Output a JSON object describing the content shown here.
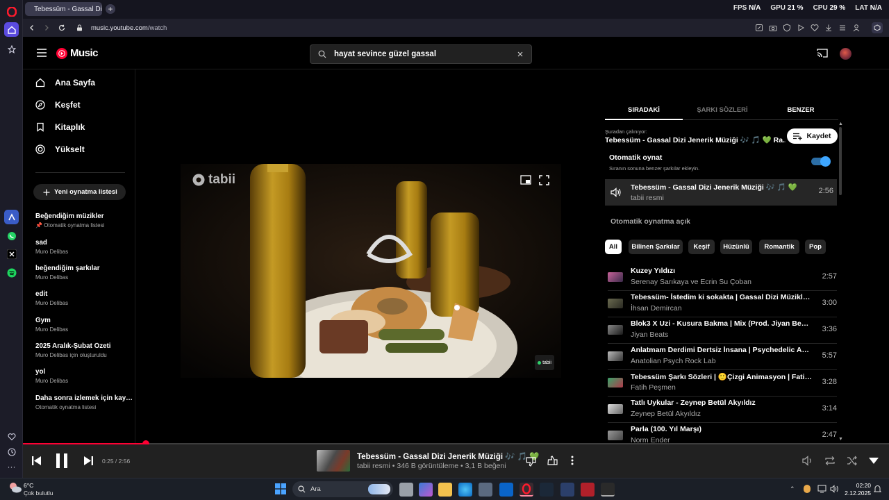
{
  "browser": {
    "tab_title": "Tebessüm - Gassal Di",
    "url_host": "music.youtube.com",
    "url_path": "/watch",
    "perf": [
      {
        "label": "FPS",
        "value": "N/A"
      },
      {
        "label": "GPU",
        "value": "21 %"
      },
      {
        "label": "CPU",
        "value": "29 %"
      },
      {
        "label": "LAT",
        "value": "N/A"
      }
    ]
  },
  "header": {
    "logo_text": "Music",
    "search_value": "hayat sevince güzel gassal"
  },
  "nav": {
    "items": [
      "Ana Sayfa",
      "Keşfet",
      "Kitaplık",
      "Yükselt"
    ],
    "new_playlist": "Yeni oynatma listesi",
    "playlists": [
      {
        "title": "Beğendiğim müzikler",
        "sub": "Otomatik oynatma listesi"
      },
      {
        "title": "sad",
        "sub": "Muro Delibas"
      },
      {
        "title": "beğendiğim şarkılar",
        "sub": "Muro Delibas"
      },
      {
        "title": "edit",
        "sub": "Muro Delibas"
      },
      {
        "title": "Gym",
        "sub": "Muro Delibas"
      },
      {
        "title": "2025 Aralık-Şubat Özeti",
        "sub": "Muro Delibas için oluşturuldu"
      },
      {
        "title": "yol",
        "sub": "Muro Delibas"
      },
      {
        "title": "Daha sonra izlemek için kayd...",
        "sub": "Otomatik oynatma listesi"
      }
    ]
  },
  "video": {
    "watermark": "tabii",
    "corner_badge": "tabii"
  },
  "panel": {
    "tabs": [
      "SIRADAKİ",
      "ŞARKI SÖZLERİ",
      "BENZER"
    ],
    "playing_from_label": "Şuradan çalınıyor:",
    "playing_from_title": "Tebessüm - Gassal Dizi Jenerik Müziği 🎶 🎵 💚 Ra...",
    "save_label": "Kaydet",
    "autoplay_title": "Otomatik oynat",
    "autoplay_desc": "Sıranın sonuna benzer şarkılar ekleyin.",
    "autoplay_on": true,
    "current": {
      "title": "Tebessüm - Gassal Dizi Jenerik Müziği 🎶 🎵 💚",
      "artist": "tabii resmi",
      "duration": "2:56"
    },
    "autoplay_section": "Otomatik oynatma açık",
    "chips": [
      "All",
      "Bilinen Şarkılar",
      "Keşif",
      "Hüzünlü",
      "Romantik",
      "Pop"
    ],
    "queue": [
      {
        "title": "Kuzey Yıldızı",
        "artist": "Serenay Sarıkaya ve Ecrin Su Çoban",
        "duration": "2:57"
      },
      {
        "title": "Tebessüm- İstedim ki sokakta | Gassal Dizi Müzikleri ...",
        "artist": "İhsan Demircan",
        "duration": "3:00"
      },
      {
        "title": "Blok3 X Uzi - Kusura Bakma | Mix (Prod. Jiyan Beats)",
        "artist": "Jiyan Beats",
        "duration": "3:36"
      },
      {
        "title": "Anlatmam Derdimi Dertsiz İnsana | Psychedelic Anato...",
        "artist": "Anatolian Psych Rock Lab",
        "duration": "5:57"
      },
      {
        "title": "Tebessüm Şarkı Sözleri | 🙂Çizgi Animasyon | Fatih P...",
        "artist": "Fatih Peşmen",
        "duration": "3:28"
      },
      {
        "title": "Tatlı Uykular - Zeynep Betül Akyıldız",
        "artist": "Zeynep Betül Akyıldız",
        "duration": "3:14"
      },
      {
        "title": "Parla (100. Yıl Marşı)",
        "artist": "Norm Ender",
        "duration": "2:47"
      }
    ]
  },
  "player": {
    "time": "0:25 / 2:56",
    "progress": 0.142,
    "title": "Tebessüm - Gassal Dizi Jenerik Müziği 🎶 🎵 💚",
    "meta": "tabii resmi • 346 B görüntüleme • 3,1 B beğeni"
  },
  "taskbar": {
    "weather_temp": "6°C",
    "weather_desc": "Çok bulutlu",
    "search_label": "Ara",
    "time": "02:20",
    "date": "2.12.2025"
  },
  "colors": {
    "accent_red": "#ff0033",
    "toggle_blue": "#3ea6ff",
    "browser_red": "#ff1b2d"
  }
}
